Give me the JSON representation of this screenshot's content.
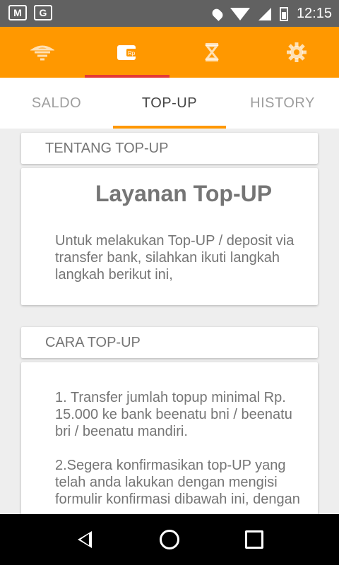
{
  "statusbar": {
    "time": "12:15",
    "icons": [
      "gmail-icon",
      "google-plus-icon",
      "location-icon",
      "wifi-icon",
      "signal-icon",
      "battery-charging-icon"
    ]
  },
  "appbar": {
    "icons": [
      "lamp-icon",
      "wallet-rp-icon",
      "hourglass-icon",
      "gear-icon"
    ],
    "active_index": 1,
    "accent": "#ff9800",
    "indicator": "#e53935"
  },
  "tabs": [
    {
      "label": "SALDO"
    },
    {
      "label": "TOP-UP"
    },
    {
      "label": "HISTORY"
    }
  ],
  "active_tab": "TOP-UP",
  "sections": {
    "tentang": {
      "header": "TENTANG TOP-UP",
      "title": "Layanan Top-UP",
      "lines": [
        "Untuk melakukan Top-UP / deposit via",
        "transfer bank, silahkan ikuti langkah",
        "langkah berikut ini,"
      ]
    },
    "cara": {
      "header": "CARA TOP-UP",
      "step1": [
        "1. Transfer jumlah topup minimal Rp.",
        "15.000 ke bank beenatu bni / beenatu",
        "bri / beenatu mandiri."
      ],
      "step2": [
        "2.Segera konfirmasikan top-UP yang",
        "telah anda lakukan dengan mengisi",
        "formulir konfirmasi dibawah ini, dengan"
      ]
    }
  },
  "navbar": {
    "icons": [
      "back-icon",
      "home-icon",
      "recents-icon"
    ]
  }
}
